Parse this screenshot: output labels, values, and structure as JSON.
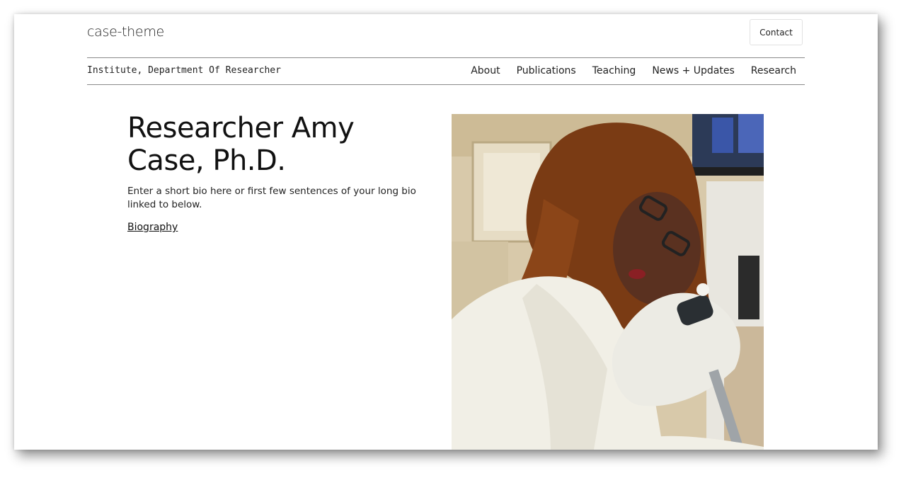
{
  "header": {
    "site_title": "case-theme",
    "contact_label": "Contact",
    "department": "Institute, Department Of Researcher"
  },
  "nav": {
    "items": [
      "About",
      "Publications",
      "Teaching",
      "News + Updates",
      "Research"
    ]
  },
  "hero": {
    "title": "Researcher Amy Case, Ph.D.",
    "bio": "Enter a short bio here or first few sentences of your long bio linked to below.",
    "link_label": "Biography"
  },
  "image": {
    "icon": "researcher-photo"
  }
}
